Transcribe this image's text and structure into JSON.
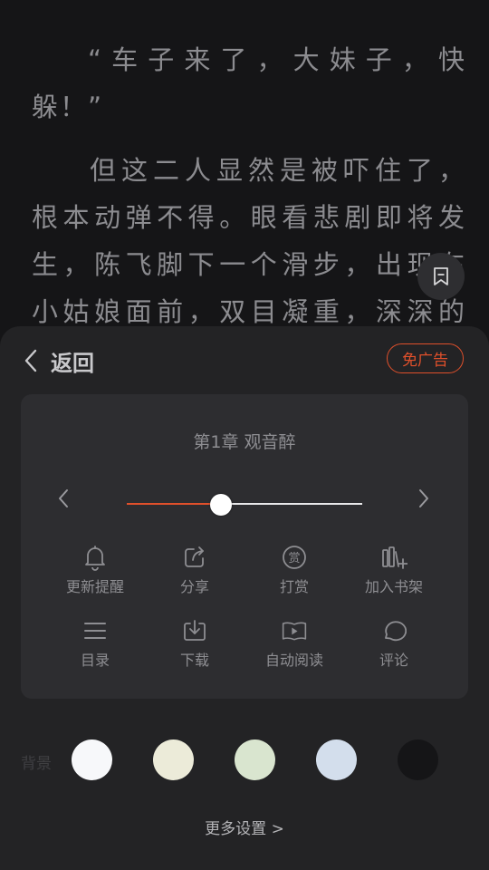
{
  "reader": {
    "paragraph1": {
      "line1": "“车子来了，大妹子，快",
      "line2": "躲！”"
    },
    "paragraph2": {
      "line1": "但这二人显然是被吓住了，",
      "line2": "根本动弹不得。眼看悲剧即将发",
      "line3": "生，陈飞脚下一个滑步，出现在",
      "line4": "小姑娘面前，双目凝重，深深的"
    }
  },
  "bookmark_button": {
    "icon": "bookmark-icon"
  },
  "panel": {
    "back_label": "返回",
    "ad_free_label": "免广告",
    "chapter_title": "第1章 观音醉",
    "progress": {
      "fraction": 0.4
    },
    "actions_row1": [
      {
        "label": "更新提醒",
        "icon": "bell-icon"
      },
      {
        "label": "分享",
        "icon": "share-icon"
      },
      {
        "label": "打赏",
        "icon": "reward-icon"
      },
      {
        "label": "加入书架",
        "icon": "bookshelf-add-icon"
      }
    ],
    "actions_row2": [
      {
        "label": "目录",
        "icon": "menu-list-icon"
      },
      {
        "label": "下载",
        "icon": "download-icon"
      },
      {
        "label": "自动阅读",
        "icon": "autoplay-icon"
      },
      {
        "label": "评论",
        "icon": "comment-icon"
      }
    ],
    "background_label": "背景",
    "backgrounds": [
      "#f7f8fa",
      "#ecebd9",
      "#d9e5cf",
      "#d3deec",
      "#151517"
    ],
    "more_settings_label": "更多设置 >"
  },
  "colors": {
    "accent": "#e0502b",
    "page_background": "#151517",
    "panel_background": "#232325",
    "card_background": "#2d2d30"
  }
}
